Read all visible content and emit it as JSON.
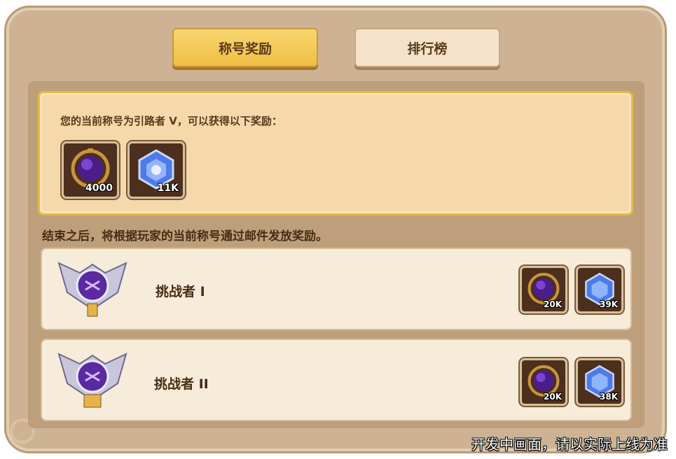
{
  "tabs": [
    {
      "label": "称号奖励",
      "active": true
    },
    {
      "label": "排行榜",
      "active": false
    }
  ],
  "current": {
    "text": "您的当前称号为引路者 V，可以获得以下奖励：",
    "rewards": [
      {
        "icon": "purple-orb-icon",
        "amount": "4000"
      },
      {
        "icon": "blue-gem-icon",
        "amount": "11K"
      }
    ]
  },
  "end_note": "结束之后，将根据玩家的当前称号通过邮件发放奖励。",
  "ranks": [
    {
      "name": "挑战者 I",
      "badge": "rank-badge-icon",
      "numeral": "I",
      "rewards": [
        {
          "icon": "purple-orb-icon",
          "amount": "20K"
        },
        {
          "icon": "blue-gem-icon",
          "amount": "39K"
        }
      ]
    },
    {
      "name": "挑战者 II",
      "badge": "rank-badge-icon",
      "numeral": "II",
      "rewards": [
        {
          "icon": "purple-orb-icon",
          "amount": "20K"
        },
        {
          "icon": "blue-gem-icon",
          "amount": "38K"
        }
      ]
    }
  ],
  "watermark": "开发中画面，请以实际上线为准",
  "colors": {
    "tab_active": "#f0bf43",
    "panel": "#bd9f7b",
    "highlight_border": "#e7b748"
  }
}
